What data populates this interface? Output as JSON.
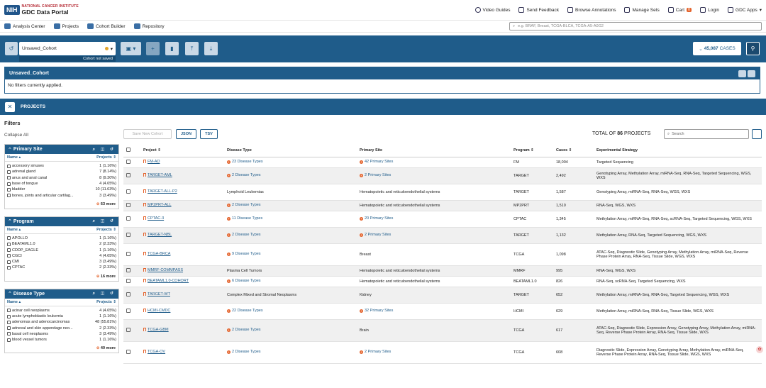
{
  "header": {
    "logo_abbr": "NIH",
    "org": "NATIONAL CANCER INSTITUTE",
    "portal": "GDC Data Portal",
    "links": [
      "Video Guides",
      "Send Feedback",
      "Browse Annotations",
      "Manage Sets",
      "Cart",
      "Login",
      "GDC Apps"
    ],
    "cart_count": "0"
  },
  "subnav": {
    "items": [
      "Analysis Center",
      "Projects",
      "Cohort Builder",
      "Repository"
    ],
    "search_placeholder": "e.g. BRAF, Breast, TCGA-BLCA, TCGA-A5-A0G2"
  },
  "cohort": {
    "name": "Unsaved_Cohort",
    "saved_status": "Cohort not saved",
    "cases_count": "45,087",
    "cases_label": "CASES",
    "panel_title": "Unsaved_Cohort",
    "no_filters": "No filters currently applied."
  },
  "projects_bar": {
    "title": "PROJECTS"
  },
  "sidebar": {
    "title": "Filters",
    "collapse": "Collapse All",
    "col_name": "Name",
    "col_projects": "Projects",
    "facets": [
      {
        "title": "Primary Site",
        "rows": [
          {
            "name": "accessory sinuses",
            "count": "1 (1.16%)"
          },
          {
            "name": "adrenal gland",
            "count": "7 (8.14%)"
          },
          {
            "name": "anus and anal canal",
            "count": "8 (9.30%)"
          },
          {
            "name": "base of tongue",
            "count": "4 (4.65%)"
          },
          {
            "name": "bladder",
            "count": "10 (11.63%)"
          },
          {
            "name": "bones, joints and articular cartilag...",
            "count": "3 (3.49%)"
          }
        ],
        "more": "63 more"
      },
      {
        "title": "Program",
        "rows": [
          {
            "name": "APOLLO",
            "count": "1 (1.16%)"
          },
          {
            "name": "BEATAML1.0",
            "count": "2 (2.33%)"
          },
          {
            "name": "CDDP_EAGLE",
            "count": "1 (1.16%)"
          },
          {
            "name": "CGCI",
            "count": "4 (4.65%)"
          },
          {
            "name": "CMI",
            "count": "3 (3.49%)"
          },
          {
            "name": "CPTAC",
            "count": "2 (2.33%)"
          }
        ],
        "more": "16 more"
      },
      {
        "title": "Disease Type",
        "rows": [
          {
            "name": "acinar cell neoplasms",
            "count": "4 (4.65%)"
          },
          {
            "name": "acute lymphoblastic leukemia",
            "count": "1 (1.16%)"
          },
          {
            "name": "adenomas and adenocarcinomas",
            "count": "48 (55.81%)"
          },
          {
            "name": "adnexal and skin appendage neo...",
            "count": "2 (2.33%)"
          },
          {
            "name": "basal cell neoplasms",
            "count": "3 (3.49%)"
          },
          {
            "name": "blood vessel tumors",
            "count": "1 (1.16%)"
          }
        ],
        "more": "40 more"
      }
    ]
  },
  "toolbar": {
    "save_cohort": "Save New Cohort",
    "json": "JSON",
    "tsv": "TSV",
    "total_prefix": "TOTAL OF",
    "total_count": "86",
    "total_suffix": "PROJECTS",
    "search_placeholder": "Search"
  },
  "table": {
    "columns": [
      "Project",
      "Disease Type",
      "Primary Site",
      "Program",
      "Cases",
      "Experimental Strategy"
    ],
    "rows": [
      {
        "project": "FM-AD",
        "disease": "23 Disease Types",
        "disease_link": true,
        "site": "42 Primary Sites",
        "site_link": true,
        "program": "FM",
        "cases": "18,004",
        "strategy": "Targeted Sequencing"
      },
      {
        "project": "TARGET-AML",
        "disease": "2 Disease Types",
        "disease_link": true,
        "site": "2 Primary Sites",
        "site_link": true,
        "program": "TARGET",
        "cases": "2,492",
        "strategy": "Genotyping Array, Methylation Array, miRNA-Seq, RNA-Seq, Targeted Sequencing, WGS, WXS"
      },
      {
        "project": "TARGET-ALL-P2",
        "disease": "Lymphoid Leukemias",
        "disease_link": false,
        "site": "Hematopoietic and reticuloendothelial systems",
        "site_link": false,
        "program": "TARGET",
        "cases": "1,587",
        "strategy": "Genotyping Array, miRNA-Seq, RNA-Seq, WGS, WXS"
      },
      {
        "project": "MP2PRT-ALL",
        "disease": "2 Disease Types",
        "disease_link": true,
        "site": "Hematopoietic and reticuloendothelial systems",
        "site_link": false,
        "program": "MP2PRT",
        "cases": "1,510",
        "strategy": "RNA-Seq, WGS, WXS"
      },
      {
        "project": "CPTAC-3",
        "disease": "11 Disease Types",
        "disease_link": true,
        "site": "20 Primary Sites",
        "site_link": true,
        "program": "CPTAC",
        "cases": "1,345",
        "strategy": "Methylation Array, miRNA-Seq, RNA-Seq, scRNA-Seq, Targeted Sequencing, WGS, WXS"
      },
      {
        "project": "TARGET-NBL",
        "disease": "2 Disease Types",
        "disease_link": true,
        "site": "2 Primary Sites",
        "site_link": true,
        "program": "TARGET",
        "cases": "1,132",
        "strategy": "Methylation Array, RNA-Seq, Targeted Sequencing, WGS, WXS"
      },
      {
        "project": "TCGA-BRCA",
        "disease": "9 Disease Types",
        "disease_link": true,
        "site": "Breast",
        "site_link": false,
        "program": "TCGA",
        "cases": "1,098",
        "strategy": "ATAC-Seq, Diagnostic Slide, Genotyping Array, Methylation Array, miRNA-Seq, Reverse Phase Protein Array, RNA-Seq, Tissue Slide, WGS, WXS"
      },
      {
        "project": "MMRF-COMMPASS",
        "disease": "Plasma Cell Tumors",
        "disease_link": false,
        "site": "Hematopoietic and reticuloendothelial systems",
        "site_link": false,
        "program": "MMRF",
        "cases": "995",
        "strategy": "RNA-Seq, WGS, WXS"
      },
      {
        "project": "BEATAML1.0-COHORT",
        "disease": "6 Disease Types",
        "disease_link": true,
        "site": "Hematopoietic and reticuloendothelial systems",
        "site_link": false,
        "program": "BEATAML1.0",
        "cases": "826",
        "strategy": "RNA-Seq, scRNA-Seq, Targeted Sequencing, WXS"
      },
      {
        "project": "TARGET-WT",
        "disease": "Complex Mixed and Stromal Neoplasms",
        "disease_link": false,
        "site": "Kidney",
        "site_link": false,
        "program": "TARGET",
        "cases": "652",
        "strategy": "Methylation Array, miRNA-Seq, RNA-Seq, Targeted Sequencing, WGS, WXS"
      },
      {
        "project": "HCMI-CMDC",
        "disease": "22 Disease Types",
        "disease_link": true,
        "site": "32 Primary Sites",
        "site_link": true,
        "program": "HCMI",
        "cases": "629",
        "strategy": "Methylation Array, miRNA-Seq, RNA-Seq, Tissue Slide, WGS, WXS"
      },
      {
        "project": "TCGA-GBM",
        "disease": "2 Disease Types",
        "disease_link": true,
        "site": "Brain",
        "site_link": false,
        "program": "TCGA",
        "cases": "617",
        "strategy": "ATAC-Seq, Diagnostic Slide, Expression Array, Genotyping Array, Methylation Array, miRNA-Seq, Reverse Phase Protein Array, RNA-Seq, Tissue Slide, WXS"
      },
      {
        "project": "TCGA-OV",
        "disease": "2 Disease Types",
        "disease_link": true,
        "site": "2 Primary Sites",
        "site_link": true,
        "program": "TCGA",
        "cases": "608",
        "strategy": "Diagnostic Slide, Expression Array, Genotyping Array, Methylation Array, miRNA-Seq, Reverse Phase Protein Array, RNA-Seq, Tissue Slide, WGS, WXS"
      }
    ]
  }
}
